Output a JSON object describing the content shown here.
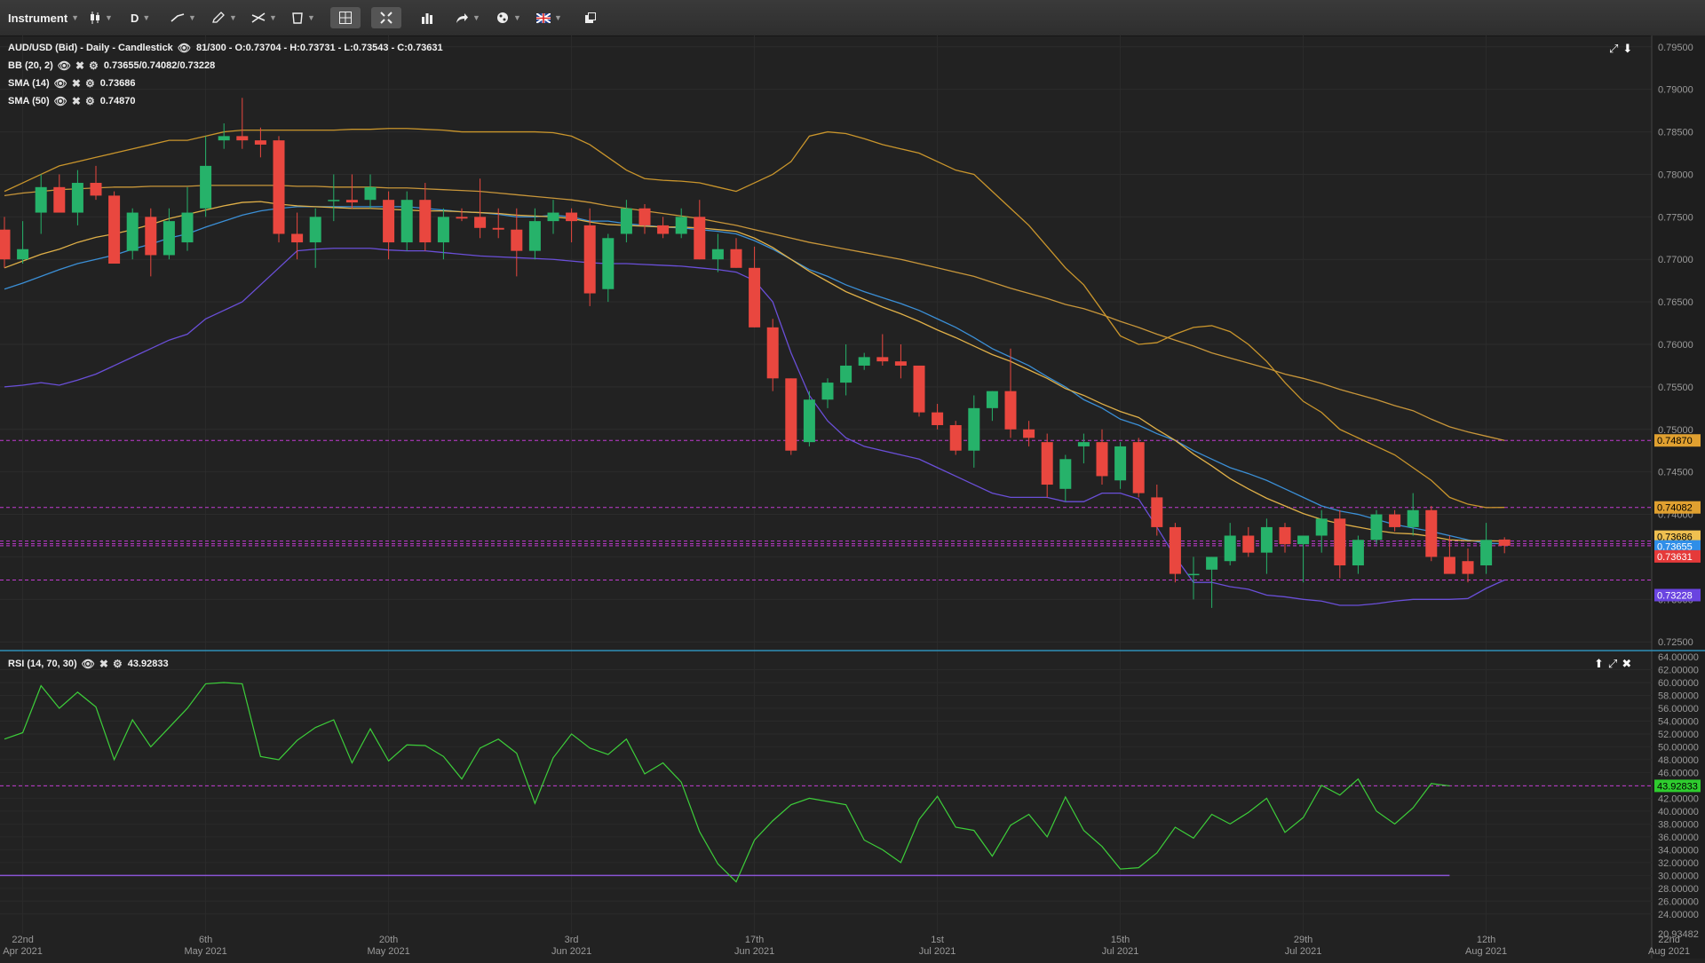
{
  "toolbar": {
    "instrument_label": "Instrument",
    "period_label": "D",
    "icons": [
      "candlestick-type-icon",
      "line-tool-icon",
      "pencil-icon",
      "drawing-tools-icon",
      "delete-icon",
      "crosshair-icon",
      "fit-icon",
      "bar-chart-icon",
      "share-icon",
      "theme-icon",
      "language-flag-icon",
      "popout-icon"
    ]
  },
  "main_legend": {
    "title": "AUD/USD (Bid) - Daily - Candlestick",
    "ohlc": "81/300 - O:0.73704 - H:0.73731 - L:0.73543 - C:0.73631",
    "bb_label": "BB (20, 2)",
    "bb_value": "0.73655/0.74082/0.73228",
    "sma14_label": "SMA (14)",
    "sma14_value": "0.73686",
    "sma50_label": "SMA (50)",
    "sma50_value": "0.74870"
  },
  "rsi_legend": {
    "label": "RSI (14, 70, 30)",
    "value": "43.92833"
  },
  "colors": {
    "background": "#222222",
    "up_candle": "#26b26a",
    "down_candle": "#e9473f",
    "bb_upper": "#c9952c",
    "bb_middle": "#3b8fd6",
    "bb_lower": "#6a4fd8",
    "sma14": "#e0b048",
    "sma50": "#c8963a",
    "rsi_line": "#3dce3a",
    "rsi_level": "#8a55d4",
    "guide_line": "#c23bd1"
  },
  "chart_data": [
    {
      "type": "candlestick",
      "instrument": "AUD/USD",
      "price_axis": {
        "min": 0.7245,
        "max": 0.7955,
        "ticks": [
          "0.79500",
          "0.79000",
          "0.78500",
          "0.78000",
          "0.77500",
          "0.77000",
          "0.76500",
          "0.76000",
          "0.75500",
          "0.75000",
          "0.74500",
          "0.74000",
          "0.73500",
          "0.73000",
          "0.72500"
        ]
      },
      "date_axis": [
        {
          "line1": "22nd",
          "line2": "Apr 2021",
          "index": 1
        },
        {
          "line1": "6th",
          "line2": "May 2021",
          "index": 11
        },
        {
          "line1": "20th",
          "line2": "May 2021",
          "index": 21
        },
        {
          "line1": "3rd",
          "line2": "Jun 2021",
          "index": 31
        },
        {
          "line1": "17th",
          "line2": "Jun 2021",
          "index": 41
        },
        {
          "line1": "1st",
          "line2": "Jul 2021",
          "index": 51
        },
        {
          "line1": "15th",
          "line2": "Jul 2021",
          "index": 61
        },
        {
          "line1": "29th",
          "line2": "Jul 2021",
          "index": 71
        },
        {
          "line1": "12th",
          "line2": "Aug 2021",
          "index": 81
        },
        {
          "line1": "22nd",
          "line2": "Aug 2021",
          "index": 91
        }
      ],
      "candles": [
        [
          0.7735,
          0.775,
          0.769,
          0.77
        ],
        [
          0.77,
          0.7745,
          0.7695,
          0.7712
        ],
        [
          0.7755,
          0.78,
          0.773,
          0.7785
        ],
        [
          0.7785,
          0.78,
          0.776,
          0.7755
        ],
        [
          0.7755,
          0.7805,
          0.774,
          0.779
        ],
        [
          0.779,
          0.781,
          0.777,
          0.7775
        ],
        [
          0.7775,
          0.778,
          0.7695,
          0.7695
        ],
        [
          0.771,
          0.776,
          0.77,
          0.7755
        ],
        [
          0.775,
          0.776,
          0.768,
          0.7705
        ],
        [
          0.7705,
          0.776,
          0.77,
          0.7745
        ],
        [
          0.772,
          0.7785,
          0.771,
          0.7755
        ],
        [
          0.776,
          0.7845,
          0.775,
          0.781
        ],
        [
          0.784,
          0.786,
          0.783,
          0.7845
        ],
        [
          0.7845,
          0.789,
          0.783,
          0.784
        ],
        [
          0.784,
          0.7855,
          0.782,
          0.7835
        ],
        [
          0.784,
          0.7845,
          0.772,
          0.773
        ],
        [
          0.773,
          0.7755,
          0.77,
          0.772
        ],
        [
          0.772,
          0.776,
          0.769,
          0.775
        ],
        [
          0.777,
          0.78,
          0.7745,
          0.777
        ],
        [
          0.777,
          0.78,
          0.776,
          0.7767
        ],
        [
          0.777,
          0.78,
          0.776,
          0.7785
        ],
        [
          0.777,
          0.778,
          0.77,
          0.772
        ],
        [
          0.772,
          0.778,
          0.771,
          0.777
        ],
        [
          0.777,
          0.779,
          0.771,
          0.772
        ],
        [
          0.772,
          0.776,
          0.77,
          0.775
        ],
        [
          0.775,
          0.776,
          0.7745,
          0.7748
        ],
        [
          0.775,
          0.7795,
          0.7725,
          0.7737
        ],
        [
          0.7737,
          0.776,
          0.7725,
          0.7735
        ],
        [
          0.7735,
          0.776,
          0.768,
          0.771
        ],
        [
          0.771,
          0.776,
          0.77,
          0.7745
        ],
        [
          0.7745,
          0.777,
          0.773,
          0.7755
        ],
        [
          0.7755,
          0.776,
          0.772,
          0.7745
        ],
        [
          0.774,
          0.776,
          0.7645,
          0.766
        ],
        [
          0.7665,
          0.773,
          0.765,
          0.7725
        ],
        [
          0.773,
          0.777,
          0.772,
          0.776
        ],
        [
          0.776,
          0.7765,
          0.773,
          0.774
        ],
        [
          0.774,
          0.775,
          0.7725,
          0.773
        ],
        [
          0.773,
          0.776,
          0.7725,
          0.775
        ],
        [
          0.775,
          0.777,
          0.77,
          0.77
        ],
        [
          0.77,
          0.773,
          0.7685,
          0.7712
        ],
        [
          0.7712,
          0.7725,
          0.769,
          0.769
        ],
        [
          0.769,
          0.7715,
          0.762,
          0.762
        ],
        [
          0.762,
          0.763,
          0.7545,
          0.756
        ],
        [
          0.756,
          0.756,
          0.747,
          0.7475
        ],
        [
          0.7485,
          0.7545,
          0.748,
          0.7535
        ],
        [
          0.7535,
          0.756,
          0.7525,
          0.7555
        ],
        [
          0.7555,
          0.76,
          0.754,
          0.7575
        ],
        [
          0.7575,
          0.759,
          0.757,
          0.7585
        ],
        [
          0.7585,
          0.7612,
          0.7575,
          0.758
        ],
        [
          0.758,
          0.76,
          0.756,
          0.7575
        ],
        [
          0.7575,
          0.7575,
          0.7515,
          0.752
        ],
        [
          0.752,
          0.753,
          0.75,
          0.7505
        ],
        [
          0.7505,
          0.751,
          0.747,
          0.7475
        ],
        [
          0.7475,
          0.754,
          0.7455,
          0.7525
        ],
        [
          0.7525,
          0.7545,
          0.751,
          0.7545
        ],
        [
          0.7545,
          0.7595,
          0.749,
          0.75
        ],
        [
          0.75,
          0.751,
          0.748,
          0.749
        ],
        [
          0.7485,
          0.7495,
          0.742,
          0.7435
        ],
        [
          0.743,
          0.747,
          0.7415,
          0.7465
        ],
        [
          0.748,
          0.7495,
          0.746,
          0.7485
        ],
        [
          0.7485,
          0.75,
          0.7435,
          0.7445
        ],
        [
          0.744,
          0.7485,
          0.743,
          0.748
        ],
        [
          0.7485,
          0.749,
          0.742,
          0.7425
        ],
        [
          0.742,
          0.7435,
          0.7375,
          0.7385
        ],
        [
          0.7385,
          0.739,
          0.732,
          0.733
        ],
        [
          0.733,
          0.735,
          0.73,
          0.733
        ],
        [
          0.7335,
          0.735,
          0.729,
          0.735
        ],
        [
          0.7345,
          0.739,
          0.734,
          0.7375
        ],
        [
          0.7375,
          0.7385,
          0.735,
          0.7355
        ],
        [
          0.7355,
          0.7395,
          0.733,
          0.7385
        ],
        [
          0.7385,
          0.739,
          0.7355,
          0.7365
        ],
        [
          0.7365,
          0.7375,
          0.732,
          0.7375
        ],
        [
          0.7375,
          0.7405,
          0.7355,
          0.7395
        ],
        [
          0.7395,
          0.7405,
          0.7325,
          0.734
        ],
        [
          0.734,
          0.7375,
          0.733,
          0.737
        ],
        [
          0.737,
          0.7405,
          0.7365,
          0.74
        ],
        [
          0.74,
          0.7405,
          0.738,
          0.7385
        ],
        [
          0.7385,
          0.7425,
          0.7375,
          0.7405
        ],
        [
          0.7405,
          0.741,
          0.7345,
          0.735
        ],
        [
          0.735,
          0.7375,
          0.734,
          0.733
        ],
        [
          0.7345,
          0.736,
          0.732,
          0.733
        ],
        [
          0.734,
          0.739,
          0.733,
          0.737
        ],
        [
          0.73704,
          0.73731,
          0.73543,
          0.73631
        ]
      ],
      "sma14": [
        0.769,
        0.7698,
        0.7706,
        0.7712,
        0.772,
        0.7726,
        0.773,
        0.7735,
        0.7741,
        0.7748,
        0.7753,
        0.7758,
        0.7763,
        0.7767,
        0.7768,
        0.7765,
        0.7763,
        0.7762,
        0.7761,
        0.776,
        0.776,
        0.7759,
        0.7758,
        0.7757,
        0.7757,
        0.7756,
        0.7755,
        0.7754,
        0.7752,
        0.7751,
        0.775,
        0.7748,
        0.7744,
        0.7741,
        0.774,
        0.7739,
        0.7738,
        0.7738,
        0.7737,
        0.7735,
        0.7733,
        0.7725,
        0.7714,
        0.77,
        0.7686,
        0.7674,
        0.7662,
        0.7653,
        0.7644,
        0.7636,
        0.7627,
        0.7617,
        0.7608,
        0.7598,
        0.7588,
        0.758,
        0.757,
        0.756,
        0.7548,
        0.754,
        0.753,
        0.7521,
        0.7514,
        0.75,
        0.7487,
        0.7471,
        0.7457,
        0.7442,
        0.743,
        0.7419,
        0.741,
        0.7401,
        0.7394,
        0.7389,
        0.7385,
        0.7381,
        0.7378,
        0.7377,
        0.7374,
        0.737,
        0.7369,
        0.7369,
        0.73686
      ],
      "sma50": [
        0.7775,
        0.7778,
        0.778,
        0.7782,
        0.7783,
        0.7784,
        0.7785,
        0.7785,
        0.7786,
        0.7786,
        0.7786,
        0.7787,
        0.7787,
        0.7787,
        0.7787,
        0.7787,
        0.7786,
        0.7786,
        0.7785,
        0.7785,
        0.7785,
        0.7784,
        0.7784,
        0.7783,
        0.7782,
        0.7781,
        0.778,
        0.7778,
        0.7776,
        0.7774,
        0.7772,
        0.777,
        0.7767,
        0.7763,
        0.776,
        0.7757,
        0.7754,
        0.7751,
        0.7748,
        0.7744,
        0.774,
        0.7735,
        0.773,
        0.7725,
        0.772,
        0.7716,
        0.7712,
        0.7708,
        0.7704,
        0.77,
        0.7695,
        0.769,
        0.7685,
        0.768,
        0.7673,
        0.7666,
        0.766,
        0.7654,
        0.7647,
        0.7642,
        0.7635,
        0.7627,
        0.762,
        0.7612,
        0.7605,
        0.7598,
        0.759,
        0.7584,
        0.7578,
        0.7572,
        0.7565,
        0.756,
        0.7554,
        0.7547,
        0.7541,
        0.7535,
        0.7528,
        0.7522,
        0.7512,
        0.7503,
        0.7497,
        0.7492,
        0.7487
      ],
      "bb_upper": [
        0.778,
        0.779,
        0.78,
        0.781,
        0.7815,
        0.782,
        0.7825,
        0.783,
        0.7835,
        0.784,
        0.784,
        0.7845,
        0.785,
        0.7852,
        0.7852,
        0.7852,
        0.7852,
        0.7852,
        0.7852,
        0.7853,
        0.7853,
        0.7854,
        0.7854,
        0.7853,
        0.7852,
        0.785,
        0.785,
        0.785,
        0.785,
        0.785,
        0.7849,
        0.7845,
        0.7835,
        0.782,
        0.7805,
        0.7795,
        0.7793,
        0.7792,
        0.779,
        0.7785,
        0.778,
        0.779,
        0.78,
        0.7815,
        0.7845,
        0.785,
        0.7848,
        0.7842,
        0.7835,
        0.783,
        0.7825,
        0.7815,
        0.7805,
        0.78,
        0.778,
        0.776,
        0.774,
        0.7715,
        0.769,
        0.767,
        0.764,
        0.761,
        0.76,
        0.7602,
        0.7612,
        0.762,
        0.7622,
        0.7615,
        0.76,
        0.758,
        0.7555,
        0.7533,
        0.752,
        0.75,
        0.749,
        0.748,
        0.747,
        0.7455,
        0.744,
        0.742,
        0.7412,
        0.7408,
        0.74082
      ],
      "bb_mid": [
        0.7665,
        0.7672,
        0.768,
        0.7688,
        0.7695,
        0.77,
        0.7705,
        0.7712,
        0.7718,
        0.7725,
        0.773,
        0.7738,
        0.7745,
        0.7752,
        0.7757,
        0.776,
        0.7762,
        0.7762,
        0.7762,
        0.7762,
        0.7762,
        0.7762,
        0.7762,
        0.776,
        0.7758,
        0.7756,
        0.7755,
        0.7753,
        0.775,
        0.775,
        0.7752,
        0.775,
        0.7745,
        0.7745,
        0.7742,
        0.774,
        0.7738,
        0.7737,
        0.7735,
        0.7733,
        0.773,
        0.7722,
        0.7712,
        0.77,
        0.7688,
        0.768,
        0.767,
        0.7662,
        0.7655,
        0.7648,
        0.764,
        0.763,
        0.762,
        0.7608,
        0.7595,
        0.7585,
        0.7575,
        0.7562,
        0.755,
        0.7535,
        0.7525,
        0.7512,
        0.7505,
        0.7495,
        0.7487,
        0.7475,
        0.7465,
        0.7455,
        0.7448,
        0.744,
        0.743,
        0.742,
        0.741,
        0.7404,
        0.74,
        0.7394,
        0.7388,
        0.7384,
        0.738,
        0.7375,
        0.737,
        0.7366,
        0.73655
      ],
      "bb_lower": [
        0.755,
        0.7552,
        0.7555,
        0.7552,
        0.7558,
        0.7565,
        0.7575,
        0.7585,
        0.7595,
        0.7605,
        0.7612,
        0.763,
        0.764,
        0.765,
        0.767,
        0.769,
        0.771,
        0.7712,
        0.7713,
        0.7713,
        0.7713,
        0.7711,
        0.771,
        0.771,
        0.7708,
        0.7706,
        0.7704,
        0.7703,
        0.7702,
        0.7701,
        0.77,
        0.7698,
        0.7696,
        0.7695,
        0.7695,
        0.7694,
        0.7693,
        0.7692,
        0.769,
        0.7688,
        0.7685,
        0.7675,
        0.765,
        0.759,
        0.754,
        0.751,
        0.749,
        0.748,
        0.7475,
        0.747,
        0.7465,
        0.7455,
        0.7445,
        0.7435,
        0.7425,
        0.742,
        0.742,
        0.742,
        0.7415,
        0.7415,
        0.7425,
        0.7425,
        0.7418,
        0.7385,
        0.735,
        0.732,
        0.732,
        0.7315,
        0.7312,
        0.7305,
        0.7303,
        0.73,
        0.7298,
        0.7293,
        0.7293,
        0.7295,
        0.7298,
        0.73,
        0.73,
        0.73,
        0.7301,
        0.7313,
        0.73228
      ],
      "guide_lines": [
        0.7487,
        0.74082,
        0.73686,
        0.73655,
        0.73631,
        0.73228
      ],
      "price_tags": [
        {
          "value": 0.7487,
          "label": "0.74870",
          "bg": "#e0a030",
          "fg": "#000000"
        },
        {
          "value": 0.74082,
          "label": "0.74082",
          "bg": "#e0a030",
          "fg": "#000000"
        },
        {
          "value": 0.73686,
          "label": "0.73686",
          "bg": "#f0c050",
          "fg": "#000000"
        },
        {
          "value": 0.73655,
          "label": "0.73655",
          "bg": "#2f8ee8",
          "fg": "#ffffff"
        },
        {
          "value": 0.73631,
          "label": "0.73631",
          "bg": "#e53a3a",
          "fg": "#ffffff"
        },
        {
          "value": 0.73228,
          "label": "0.73228",
          "bg": "#6a44e0",
          "fg": "#ffffff"
        }
      ]
    },
    {
      "type": "line",
      "name": "RSI (14, 70, 30)",
      "y_axis": {
        "min": 20.93482,
        "max": 64.0,
        "ticks": [
          "64.00000",
          "62.00000",
          "60.00000",
          "58.00000",
          "56.00000",
          "54.00000",
          "52.00000",
          "50.00000",
          "48.00000",
          "46.00000",
          "44.00000",
          "42.00000",
          "40.00000",
          "38.00000",
          "36.00000",
          "34.00000",
          "32.00000",
          "30.00000",
          "28.00000",
          "26.00000",
          "24.00000",
          "20.93482"
        ]
      },
      "level": 30,
      "current": {
        "value": 43.92833,
        "label": "43.92833"
      },
      "values": [
        51.2,
        52.2,
        59.5,
        56.0,
        58.5,
        56.2,
        48.0,
        54.2,
        50.0,
        53.0,
        56.0,
        59.8,
        60.0,
        59.8,
        48.5,
        48.0,
        51.0,
        53.0,
        54.2,
        47.5,
        52.8,
        47.8,
        50.3,
        50.2,
        48.5,
        45.0,
        49.8,
        51.2,
        49.0,
        41.2,
        48.3,
        52.0,
        49.8,
        48.8,
        51.2,
        45.8,
        47.5,
        44.5,
        36.8,
        31.8,
        29.0,
        35.5,
        38.5,
        41.0,
        42.0,
        41.5,
        41.0,
        35.5,
        34.0,
        32.0,
        38.7,
        42.3,
        37.5,
        37.0,
        33.0,
        37.8,
        39.5,
        36.0,
        42.2,
        37.0,
        34.5,
        31.0,
        31.2,
        33.5,
        37.5,
        35.8,
        39.5,
        38.0,
        39.8,
        42.0,
        36.7,
        39.0,
        44.0,
        42.5,
        45.0,
        40.0,
        38.0,
        40.5,
        44.3,
        43.92833
      ]
    }
  ]
}
